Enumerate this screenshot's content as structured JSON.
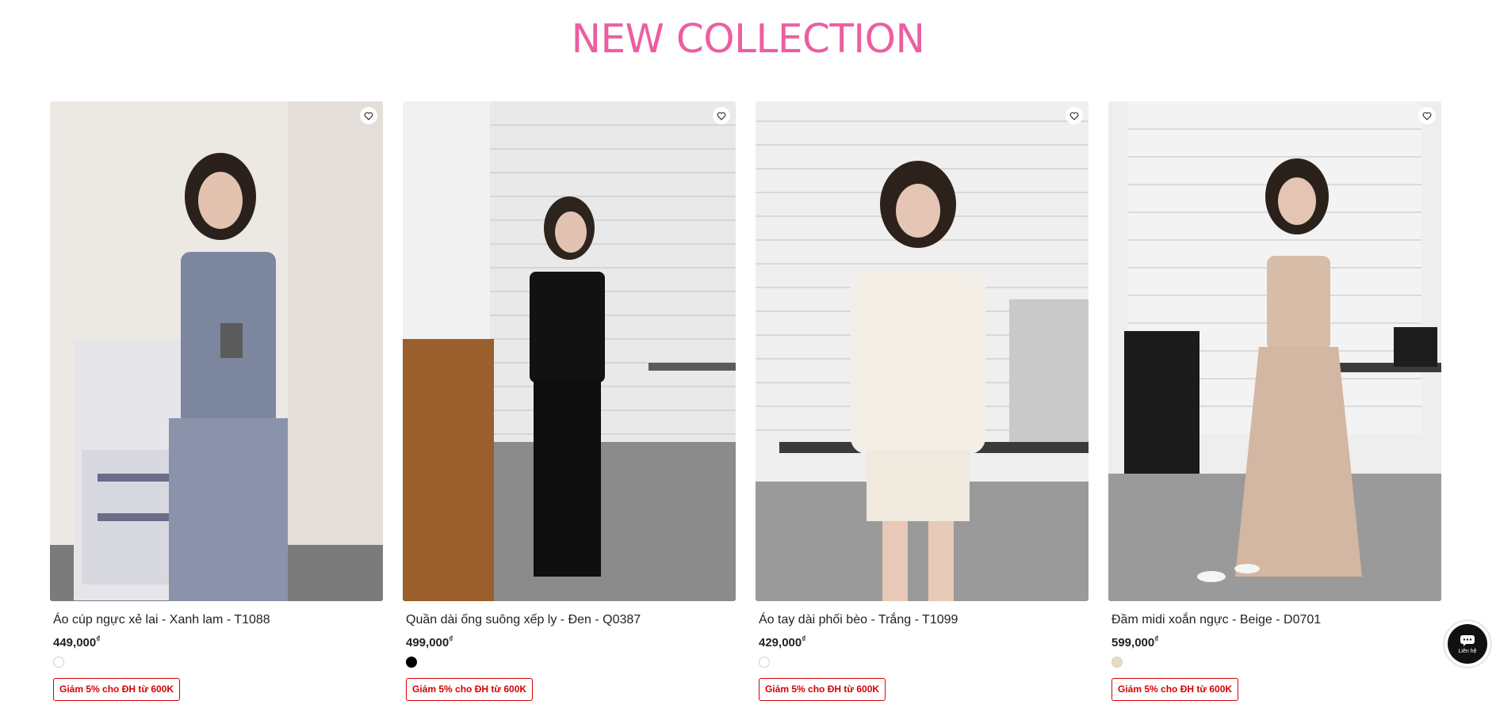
{
  "section": {
    "title": "NEW COLLECTION",
    "title_color": "#ec5ea0"
  },
  "products": [
    {
      "name": "Áo cúp ngực xẻ lai - Xanh lam - T1088",
      "price": "449,000",
      "currency": "₫",
      "swatch_color": "#ffffff",
      "promo": "Giảm 5% cho ĐH từ 600K",
      "wishlist_icon": "heart-outline-icon"
    },
    {
      "name": "Quần dài ống suông xếp ly - Đen - Q0387",
      "price": "499,000",
      "currency": "₫",
      "swatch_color": "#000000",
      "promo": "Giảm 5% cho ĐH từ 600K",
      "wishlist_icon": "heart-outline-icon"
    },
    {
      "name": "Áo tay dài phối bèo - Trắng - T1099",
      "price": "429,000",
      "currency": "₫",
      "swatch_color": "#ffffff",
      "promo": "Giảm 5% cho ĐH từ 600K",
      "wishlist_icon": "heart-outline-icon"
    },
    {
      "name": "Đầm midi xoắn ngực - Beige - D0701",
      "price": "599,000",
      "currency": "₫",
      "swatch_color": "#e9dcc0",
      "promo": "Giảm 5% cho ĐH từ 600K",
      "wishlist_icon": "heart-outline-icon"
    }
  ],
  "chat_widget": {
    "label": "Liên hệ",
    "icon": "chat-bubble-icon"
  },
  "colors": {
    "promo": "#d70000",
    "text": "#222222"
  }
}
